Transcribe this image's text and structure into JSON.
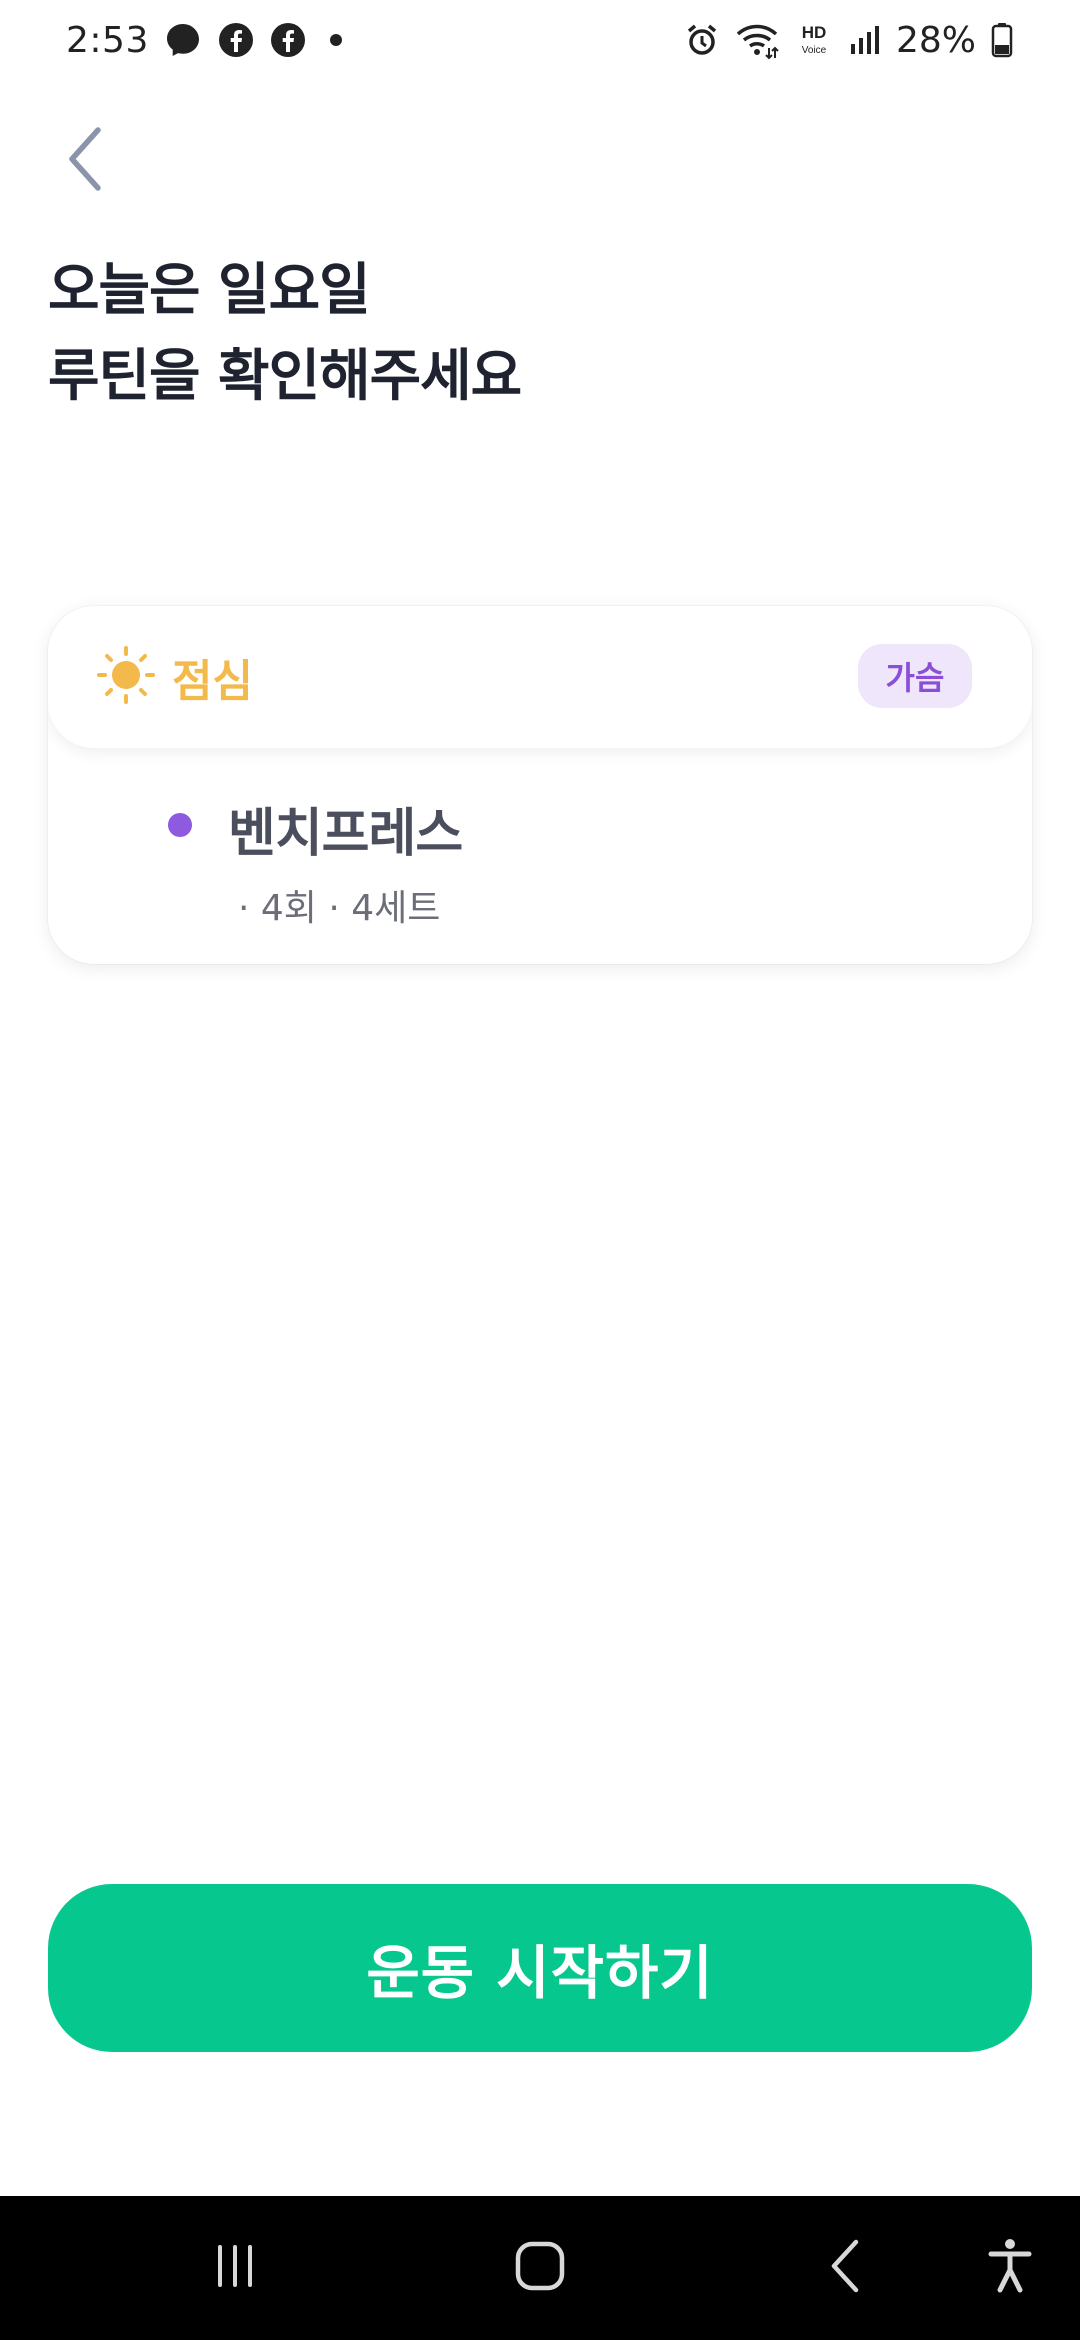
{
  "status_bar": {
    "time": "2:53",
    "left_icons": [
      "messenger-icon",
      "facebook-icon",
      "facebook-icon",
      "notification-dot-icon"
    ],
    "right_icons": [
      "alarm-icon",
      "wifi-icon",
      "hd-voice-icon",
      "signal-icon",
      "battery-icon"
    ],
    "hd_top": "HD",
    "hd_bottom": "Voice",
    "battery": "28%"
  },
  "header": {
    "back_icon": "chevron-left-icon",
    "title_line1": "오늘은 일요일",
    "title_line2": "루틴을 확인해주세요"
  },
  "routine": {
    "meal_icon": "sun-icon",
    "meal_label": "점심",
    "muscle_tag": "가슴",
    "exercises": [
      {
        "name": "벤치프레스",
        "detail": "· 4회 · 4세트"
      }
    ]
  },
  "start_button": {
    "label": "운동 시작하기"
  },
  "nav_bar": {
    "icons": [
      "recent-apps-icon",
      "home-icon",
      "back-icon",
      "accessibility-icon"
    ]
  },
  "colors": {
    "accent_green": "#06c88f",
    "meal_yellow": "#f3b94a",
    "tag_purple": "#8a4fd6",
    "tag_bg": "#efe6fb",
    "dot_purple": "#8d5ae0"
  }
}
